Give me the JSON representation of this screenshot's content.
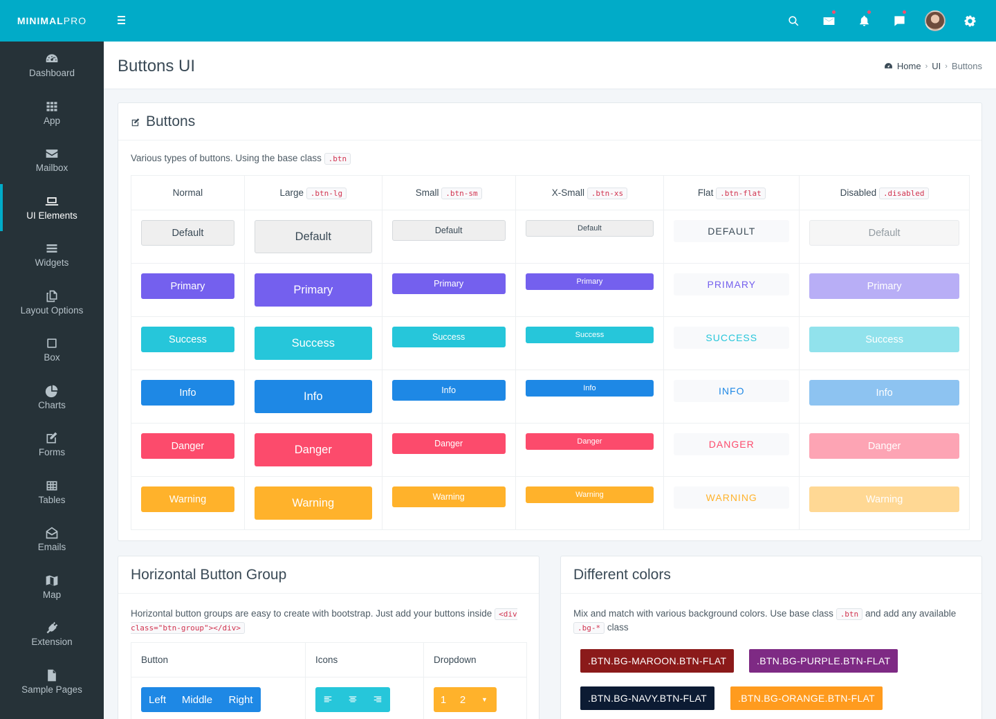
{
  "brand": {
    "bold": "MINIMAL",
    "light": "PRO"
  },
  "topbar": {
    "icons": [
      "search-icon",
      "mail-icon",
      "bell-icon",
      "chat-icon",
      "avatar",
      "gear-icon"
    ]
  },
  "sidebar": {
    "items": [
      {
        "label": "Dashboard",
        "icon": "dashboard-icon"
      },
      {
        "label": "App",
        "icon": "grid-icon"
      },
      {
        "label": "Mailbox",
        "icon": "envelope-icon"
      },
      {
        "label": "UI Elements",
        "icon": "laptop-icon"
      },
      {
        "label": "Widgets",
        "icon": "bars-icon"
      },
      {
        "label": "Layout Options",
        "icon": "copy-icon"
      },
      {
        "label": "Box",
        "icon": "square-icon"
      },
      {
        "label": "Charts",
        "icon": "pie-icon"
      },
      {
        "label": "Forms",
        "icon": "edit-icon"
      },
      {
        "label": "Tables",
        "icon": "table-icon"
      },
      {
        "label": "Emails",
        "icon": "envelope-open-icon"
      },
      {
        "label": "Map",
        "icon": "map-icon"
      },
      {
        "label": "Extension",
        "icon": "plug-icon"
      },
      {
        "label": "Sample Pages",
        "icon": "file-icon"
      }
    ]
  },
  "header": {
    "title": "Buttons UI",
    "breadcrumb": {
      "home": "Home",
      "ui": "UI",
      "current": "Buttons"
    }
  },
  "buttons_box": {
    "title": "Buttons",
    "desc": "Various types of buttons. Using the base class",
    "desc_code": ".btn",
    "columns": [
      {
        "label": "Normal",
        "code": ""
      },
      {
        "label": "Large",
        "code": ".btn-lg"
      },
      {
        "label": "Small",
        "code": ".btn-sm"
      },
      {
        "label": "X-Small",
        "code": ".btn-xs"
      },
      {
        "label": "Flat",
        "code": ".btn-flat"
      },
      {
        "label": "Disabled",
        "code": ".disabled"
      }
    ],
    "rows": [
      {
        "key": "default",
        "label": "Default",
        "flat": "DEFAULT"
      },
      {
        "key": "primary",
        "label": "Primary",
        "flat": "PRIMARY"
      },
      {
        "key": "success",
        "label": "Success",
        "flat": "SUCCESS"
      },
      {
        "key": "info",
        "label": "Info",
        "flat": "INFO"
      },
      {
        "key": "danger",
        "label": "Danger",
        "flat": "DANGER"
      },
      {
        "key": "warning",
        "label": "Warning",
        "flat": "WARNING"
      }
    ]
  },
  "group_box": {
    "title": "Horizontal Button Group",
    "desc": "Horizontal button groups are easy to create with bootstrap. Just add your buttons inside",
    "desc_code": "<div class=\"btn-group\"></div>",
    "headers": [
      "Button",
      "Icons",
      "Dropdown"
    ],
    "buttons": [
      "Left",
      "Middle",
      "Right"
    ],
    "dropdown": [
      "1",
      "2"
    ]
  },
  "colors_box": {
    "title": "Different colors",
    "desc_a": "Mix and match with various background colors. Use base class",
    "code_a": ".btn",
    "desc_b": "and add any available",
    "code_b": ".bg-*",
    "desc_c": "class",
    "buttons": [
      {
        "label": ".BTN.BG-MAROON.BTN-FLAT",
        "color": "#8b1a1a"
      },
      {
        "label": ".BTN.BG-PURPLE.BTN-FLAT",
        "color": "#7e2a84"
      },
      {
        "label": ".BTN.BG-NAVY.BTN-FLAT",
        "color": "#0c1b33"
      },
      {
        "label": ".BTN.BG-ORANGE.BTN-FLAT",
        "color": "#ff9b1e"
      }
    ]
  },
  "colors": {
    "accent": "#01abc8",
    "sidebar": "#263238"
  }
}
